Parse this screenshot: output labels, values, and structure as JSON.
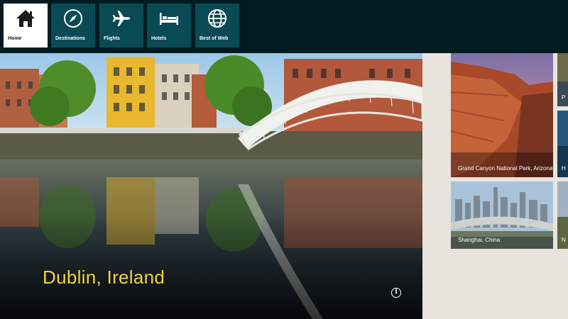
{
  "nav": {
    "items": [
      {
        "label": "Home",
        "icon": "home-icon",
        "active": true
      },
      {
        "label": "Destinations",
        "icon": "compass-icon",
        "active": false
      },
      {
        "label": "Flights",
        "icon": "airplane-icon",
        "active": false
      },
      {
        "label": "Hotels",
        "icon": "bed-icon",
        "active": false
      },
      {
        "label": "Best of Web",
        "icon": "globe-icon",
        "active": false
      }
    ]
  },
  "hero": {
    "title": "Dublin, Ireland",
    "info_icon": "info-icon",
    "title_color": "#f3d23a"
  },
  "destinations": [
    {
      "caption": "Grand Canyon National Park, Arizona"
    },
    {
      "caption": "Shanghai, China"
    }
  ],
  "peek_tiles": [
    {
      "caption": "P"
    },
    {
      "caption": "H"
    },
    {
      "caption": "N"
    }
  ],
  "colors": {
    "nav_bg": "#001c21",
    "tile_bg": "#0a4a55",
    "active_tile_bg": "#ffffff",
    "page_bg": "#e8e4dd"
  }
}
